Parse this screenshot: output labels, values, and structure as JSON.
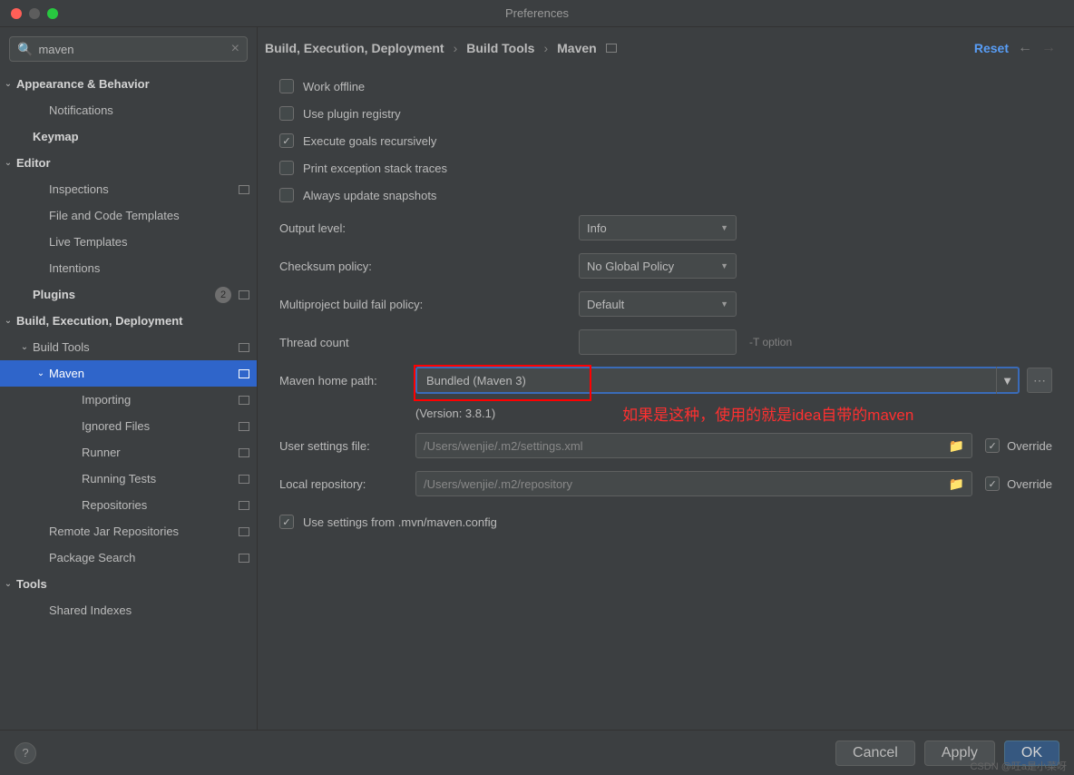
{
  "window": {
    "title": "Preferences"
  },
  "search": {
    "value": "maven"
  },
  "sidebar": {
    "items": [
      {
        "label": "Appearance & Behavior",
        "bold": true,
        "chev": "⌄",
        "indent": "0c"
      },
      {
        "label": "Notifications",
        "indent": "1"
      },
      {
        "label": "Keymap",
        "bold": true,
        "indent": "0"
      },
      {
        "label": "Editor",
        "bold": true,
        "chev": "⌄",
        "indent": "0c"
      },
      {
        "label": "Inspections",
        "indent": "1",
        "proj": true
      },
      {
        "label": "File and Code Templates",
        "indent": "1"
      },
      {
        "label": "Live Templates",
        "indent": "1"
      },
      {
        "label": "Intentions",
        "indent": "1"
      },
      {
        "label": "Plugins",
        "bold": true,
        "indent": "0",
        "badge": "2",
        "proj": true
      },
      {
        "label": "Build, Execution, Deployment",
        "bold": true,
        "chev": "⌄",
        "indent": "0c"
      },
      {
        "label": "Build Tools",
        "chev": "⌄",
        "indent": "1c",
        "proj": true
      },
      {
        "label": "Maven",
        "chev": "⌄",
        "indent": "2c",
        "proj": true,
        "selected": true
      },
      {
        "label": "Importing",
        "indent": "3",
        "proj": true
      },
      {
        "label": "Ignored Files",
        "indent": "3",
        "proj": true
      },
      {
        "label": "Runner",
        "indent": "3",
        "proj": true
      },
      {
        "label": "Running Tests",
        "indent": "3",
        "proj": true
      },
      {
        "label": "Repositories",
        "indent": "3",
        "proj": true
      },
      {
        "label": "Remote Jar Repositories",
        "indent": "1",
        "proj": true
      },
      {
        "label": "Package Search",
        "indent": "1",
        "proj": true
      },
      {
        "label": "Tools",
        "bold": true,
        "chev": "⌄",
        "indent": "0c"
      },
      {
        "label": "Shared Indexes",
        "indent": "1"
      }
    ]
  },
  "breadcrumb": {
    "items": [
      "Build, Execution, Deployment",
      "Build Tools",
      "Maven"
    ],
    "reset": "Reset"
  },
  "checks": {
    "work_offline": "Work offline",
    "use_plugin": "Use plugin registry",
    "execute_goals": "Execute goals recursively",
    "print_exception": "Print exception stack traces",
    "always_update": "Always update snapshots",
    "use_settings": "Use settings from .mvn/maven.config"
  },
  "fields": {
    "output_level": {
      "label": "Output level:",
      "value": "Info"
    },
    "checksum": {
      "label": "Checksum policy:",
      "value": "No Global Policy"
    },
    "multiproject": {
      "label": "Multiproject build fail policy:",
      "value": "Default"
    },
    "thread_count": {
      "label": "Thread count",
      "hint": "-T option"
    },
    "maven_home": {
      "label": "Maven home path:",
      "value": "Bundled (Maven 3)"
    },
    "version": "(Version: 3.8.1)",
    "annotation": "如果是这种，使用的就是idea自带的maven",
    "user_settings": {
      "label": "User settings file:",
      "value": "/Users/wenjie/.m2/settings.xml"
    },
    "local_repo": {
      "label": "Local repository:",
      "value": "/Users/wenjie/.m2/repository"
    },
    "override": "Override"
  },
  "footer": {
    "cancel": "Cancel",
    "apply": "Apply",
    "ok": "OK"
  },
  "watermark": "CSDN @旺a是小菜呀"
}
